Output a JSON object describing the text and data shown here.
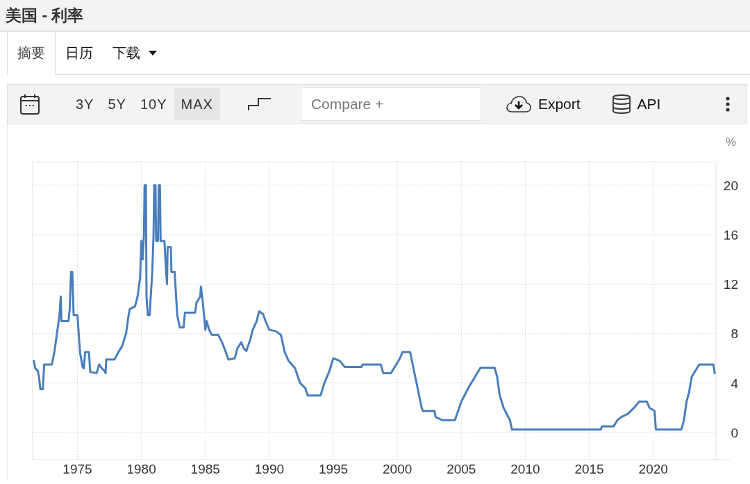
{
  "window": {
    "title": "美国 - 利率"
  },
  "tabs": [
    {
      "label": "摘要",
      "selected": true,
      "kind": "plain"
    },
    {
      "label": "日历",
      "selected": false,
      "kind": "plain"
    },
    {
      "label": "下载",
      "selected": false,
      "kind": "dropdown"
    }
  ],
  "toolbar": {
    "ranges": [
      {
        "label": "3Y",
        "selected": false
      },
      {
        "label": "5Y",
        "selected": false
      },
      {
        "label": "10Y",
        "selected": false
      },
      {
        "label": "MAX",
        "selected": true
      }
    ],
    "compare": {
      "placeholder": "Compare +"
    },
    "buttons": [
      {
        "label": "Export",
        "kind": "export"
      },
      {
        "label": "API",
        "kind": "api"
      }
    ]
  },
  "chart": {
    "chart_data": {
      "type": "line",
      "grid": true,
      "ylabel": "%",
      "xlim": [
        1971.5,
        2024.9
      ],
      "ylim": [
        -2.2,
        21.9
      ],
      "xticks": [
        1975,
        1980,
        1985,
        1990,
        1995,
        2000,
        2005,
        2010,
        2015,
        2020
      ],
      "yticks": [
        0,
        4,
        8,
        12,
        16,
        20
      ],
      "x": [
        1971.6,
        1971.7,
        1971.9,
        1972.0,
        1972.1,
        1972.3,
        1972.4,
        1973.0,
        1973.2,
        1973.4,
        1973.6,
        1973.7,
        1973.75,
        1974.3,
        1974.4,
        1974.5,
        1974.6,
        1974.7,
        1975.0,
        1975.2,
        1975.4,
        1975.5,
        1975.6,
        1975.9,
        1976.0,
        1976.5,
        1976.7,
        1976.9,
        1977.1,
        1977.2,
        1977.25,
        1977.9,
        1978.2,
        1978.5,
        1978.8,
        1979.0,
        1979.1,
        1979.5,
        1979.7,
        1979.9,
        1979.95,
        1980.0,
        1980.1,
        1980.2,
        1980.25,
        1980.35,
        1980.4,
        1980.5,
        1980.65,
        1980.7,
        1980.85,
        1980.95,
        1981.0,
        1981.1,
        1981.15,
        1981.3,
        1981.35,
        1981.45,
        1981.5,
        1981.8,
        1981.9,
        1982.0,
        1982.05,
        1982.3,
        1982.35,
        1982.6,
        1982.8,
        1983.0,
        1983.3,
        1983.4,
        1984.2,
        1984.3,
        1984.6,
        1984.65,
        1984.8,
        1985.0,
        1985.1,
        1985.3,
        1985.5,
        1986.0,
        1986.3,
        1986.6,
        1986.8,
        1987.3,
        1987.5,
        1987.8,
        1988.0,
        1988.2,
        1988.5,
        1988.7,
        1989.0,
        1989.2,
        1989.5,
        1989.7,
        1990.0,
        1990.5,
        1990.9,
        1991.2,
        1991.5,
        1992.0,
        1992.4,
        1992.8,
        1993.0,
        1994.0,
        1994.3,
        1994.7,
        1995.0,
        1995.5,
        1995.9,
        1997.2,
        1997.3,
        1998.7,
        1998.9,
        1999.5,
        1999.8,
        2000.2,
        2000.4,
        2001.0,
        2001.3,
        2001.6,
        2001.9,
        2002.0,
        2002.9,
        2003.0,
        2003.5,
        2004.5,
        2005.0,
        2005.6,
        2006.5,
        2007.6,
        2007.8,
        2008.0,
        2008.3,
        2008.8,
        2008.95,
        2015.9,
        2016.0,
        2016.9,
        2017.2,
        2017.5,
        2018.0,
        2018.5,
        2018.9,
        2019.5,
        2019.7,
        2020.1,
        2020.2,
        2022.2,
        2022.4,
        2022.6,
        2022.8,
        2023.0,
        2023.3,
        2023.6,
        2024.7,
        2024.8
      ],
      "series": [
        {
          "color": "#4a7ebb",
          "values": [
            5.8,
            5.2,
            5.0,
            4.5,
            3.5,
            3.5,
            5.5,
            5.5,
            6.5,
            8.0,
            9.5,
            11.0,
            9.0,
            9.0,
            10.0,
            13.0,
            13.0,
            9.5,
            9.5,
            6.5,
            5.3,
            5.2,
            6.5,
            6.5,
            4.9,
            4.8,
            5.5,
            5.2,
            5.0,
            4.8,
            5.9,
            5.9,
            6.5,
            7.0,
            8.0,
            9.5,
            10.0,
            10.2,
            11.0,
            12.5,
            14.0,
            15.5,
            14.0,
            16.0,
            20.0,
            20.0,
            11.0,
            9.5,
            9.5,
            10.5,
            13.0,
            16.0,
            20.0,
            20.0,
            15.5,
            15.5,
            20.0,
            20.0,
            15.5,
            15.5,
            13.5,
            12.0,
            15.0,
            15.0,
            13.0,
            13.0,
            9.5,
            8.5,
            8.5,
            9.7,
            9.7,
            10.5,
            11.0,
            11.8,
            10.5,
            8.3,
            9.0,
            8.3,
            7.9,
            7.9,
            7.3,
            6.5,
            5.9,
            6.0,
            6.8,
            7.3,
            6.8,
            6.6,
            7.5,
            8.3,
            9.0,
            9.8,
            9.6,
            9.0,
            8.3,
            8.2,
            7.9,
            6.5,
            5.8,
            5.2,
            4.0,
            3.6,
            3.0,
            3.0,
            4.0,
            5.0,
            6.0,
            5.8,
            5.3,
            5.3,
            5.5,
            5.5,
            4.8,
            4.8,
            5.3,
            6.0,
            6.5,
            6.5,
            5.0,
            3.5,
            2.0,
            1.75,
            1.75,
            1.25,
            1.0,
            1.0,
            2.5,
            3.7,
            5.25,
            5.25,
            4.5,
            3.0,
            2.0,
            1.0,
            0.25,
            0.25,
            0.5,
            0.5,
            1.0,
            1.25,
            1.5,
            2.0,
            2.5,
            2.5,
            2.0,
            1.75,
            0.25,
            0.25,
            1.0,
            2.5,
            3.25,
            4.5,
            5.0,
            5.5,
            5.5,
            4.8
          ]
        }
      ]
    }
  }
}
